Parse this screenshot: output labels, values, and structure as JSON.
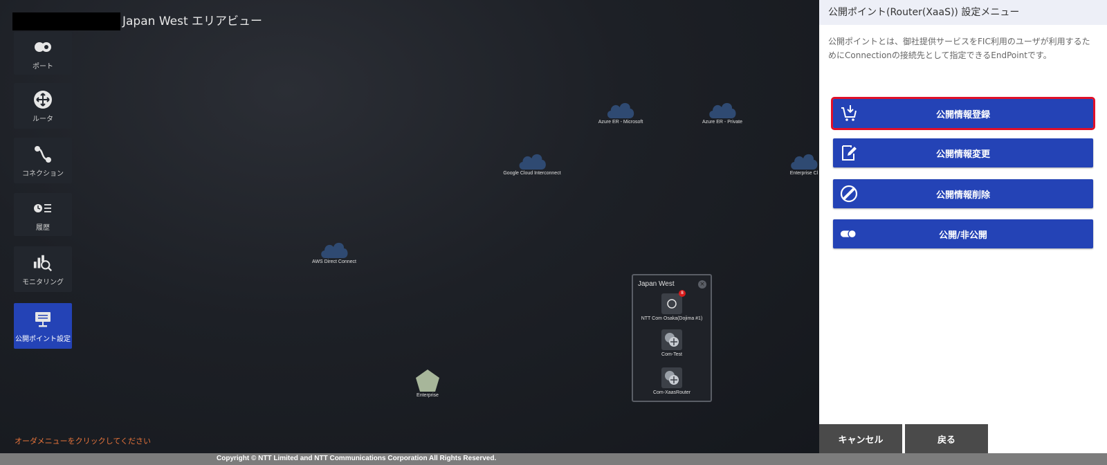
{
  "header": {
    "area_title": "Japan West エリアビュー"
  },
  "sidebar": {
    "items": [
      {
        "label": "ポート",
        "icon": "port-icon"
      },
      {
        "label": "ルータ",
        "icon": "router-icon"
      },
      {
        "label": "コネクション",
        "icon": "connection-icon"
      },
      {
        "label": "履歴",
        "icon": "history-icon"
      },
      {
        "label": "モニタリング",
        "icon": "monitoring-icon"
      },
      {
        "label": "公開ポイント設定",
        "icon": "public-point-icon",
        "active": true
      }
    ]
  },
  "map": {
    "clouds": [
      {
        "label": "Azure ER - Microsoft"
      },
      {
        "label": "Azure ER - Private"
      },
      {
        "label": "Google Cloud Interconnect"
      },
      {
        "label": "Enterprise Cl"
      },
      {
        "label": "AWS Direct Connect"
      }
    ],
    "enterprise": {
      "label": "Enterprise"
    },
    "popup": {
      "title": "Japan West",
      "items": [
        {
          "label": "NTT Com Osaka(Dojima #1)",
          "badge": "8"
        },
        {
          "label": "Com-Test"
        },
        {
          "label": "Com-XaasRouter"
        }
      ]
    },
    "order_hint": "オーダメニューをクリックしてください"
  },
  "panel": {
    "title": "公開ポイント(Router(XaaS)) 設定メニュー",
    "description": "公開ポイントとは、御社提供サービスをFIC利用のユーザが利用するためにConnectionの接続先として指定できるEndPointです。",
    "buttons": [
      {
        "label": "公開情報登録",
        "icon": "cart-download-icon"
      },
      {
        "label": "公開情報変更",
        "icon": "edit-document-icon"
      },
      {
        "label": "公開情報削除",
        "icon": "prohibit-icon"
      },
      {
        "label": "公開/非公開",
        "icon": "toggle-icon"
      }
    ],
    "cancel_label": "キャンセル",
    "back_label": "戻る"
  },
  "footer": {
    "copyright": "Copyright © NTT Limited and NTT Communications Corporation All Rights Reserved."
  },
  "colors": {
    "accent": "#2443b6",
    "highlight": "#e0102a",
    "hint": "#e8743b",
    "cloud": "#2f4a72"
  }
}
